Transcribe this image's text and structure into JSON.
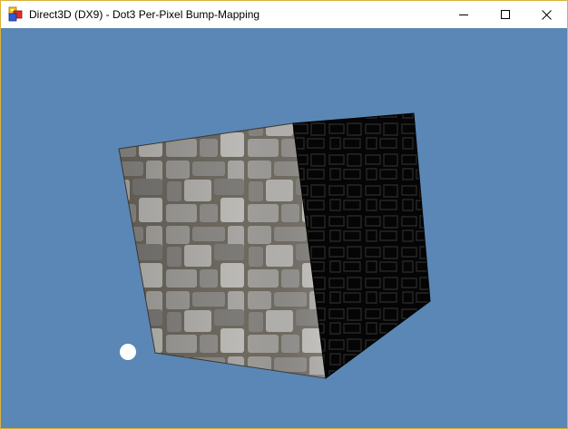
{
  "window": {
    "title": "Direct3D (DX9) - Dot3 Per-Pixel Bump-Mapping",
    "icon": "directx-app-icon",
    "controls": {
      "minimize": "minimize-icon",
      "maximize": "maximize-icon",
      "close": "close-icon"
    }
  },
  "scene": {
    "background_color": "#5a87b5",
    "objects": [
      {
        "name": "bump-mapped-cube",
        "texture": "stone-wall"
      },
      {
        "name": "light-source-marker",
        "color": "#ffffff"
      }
    ]
  }
}
